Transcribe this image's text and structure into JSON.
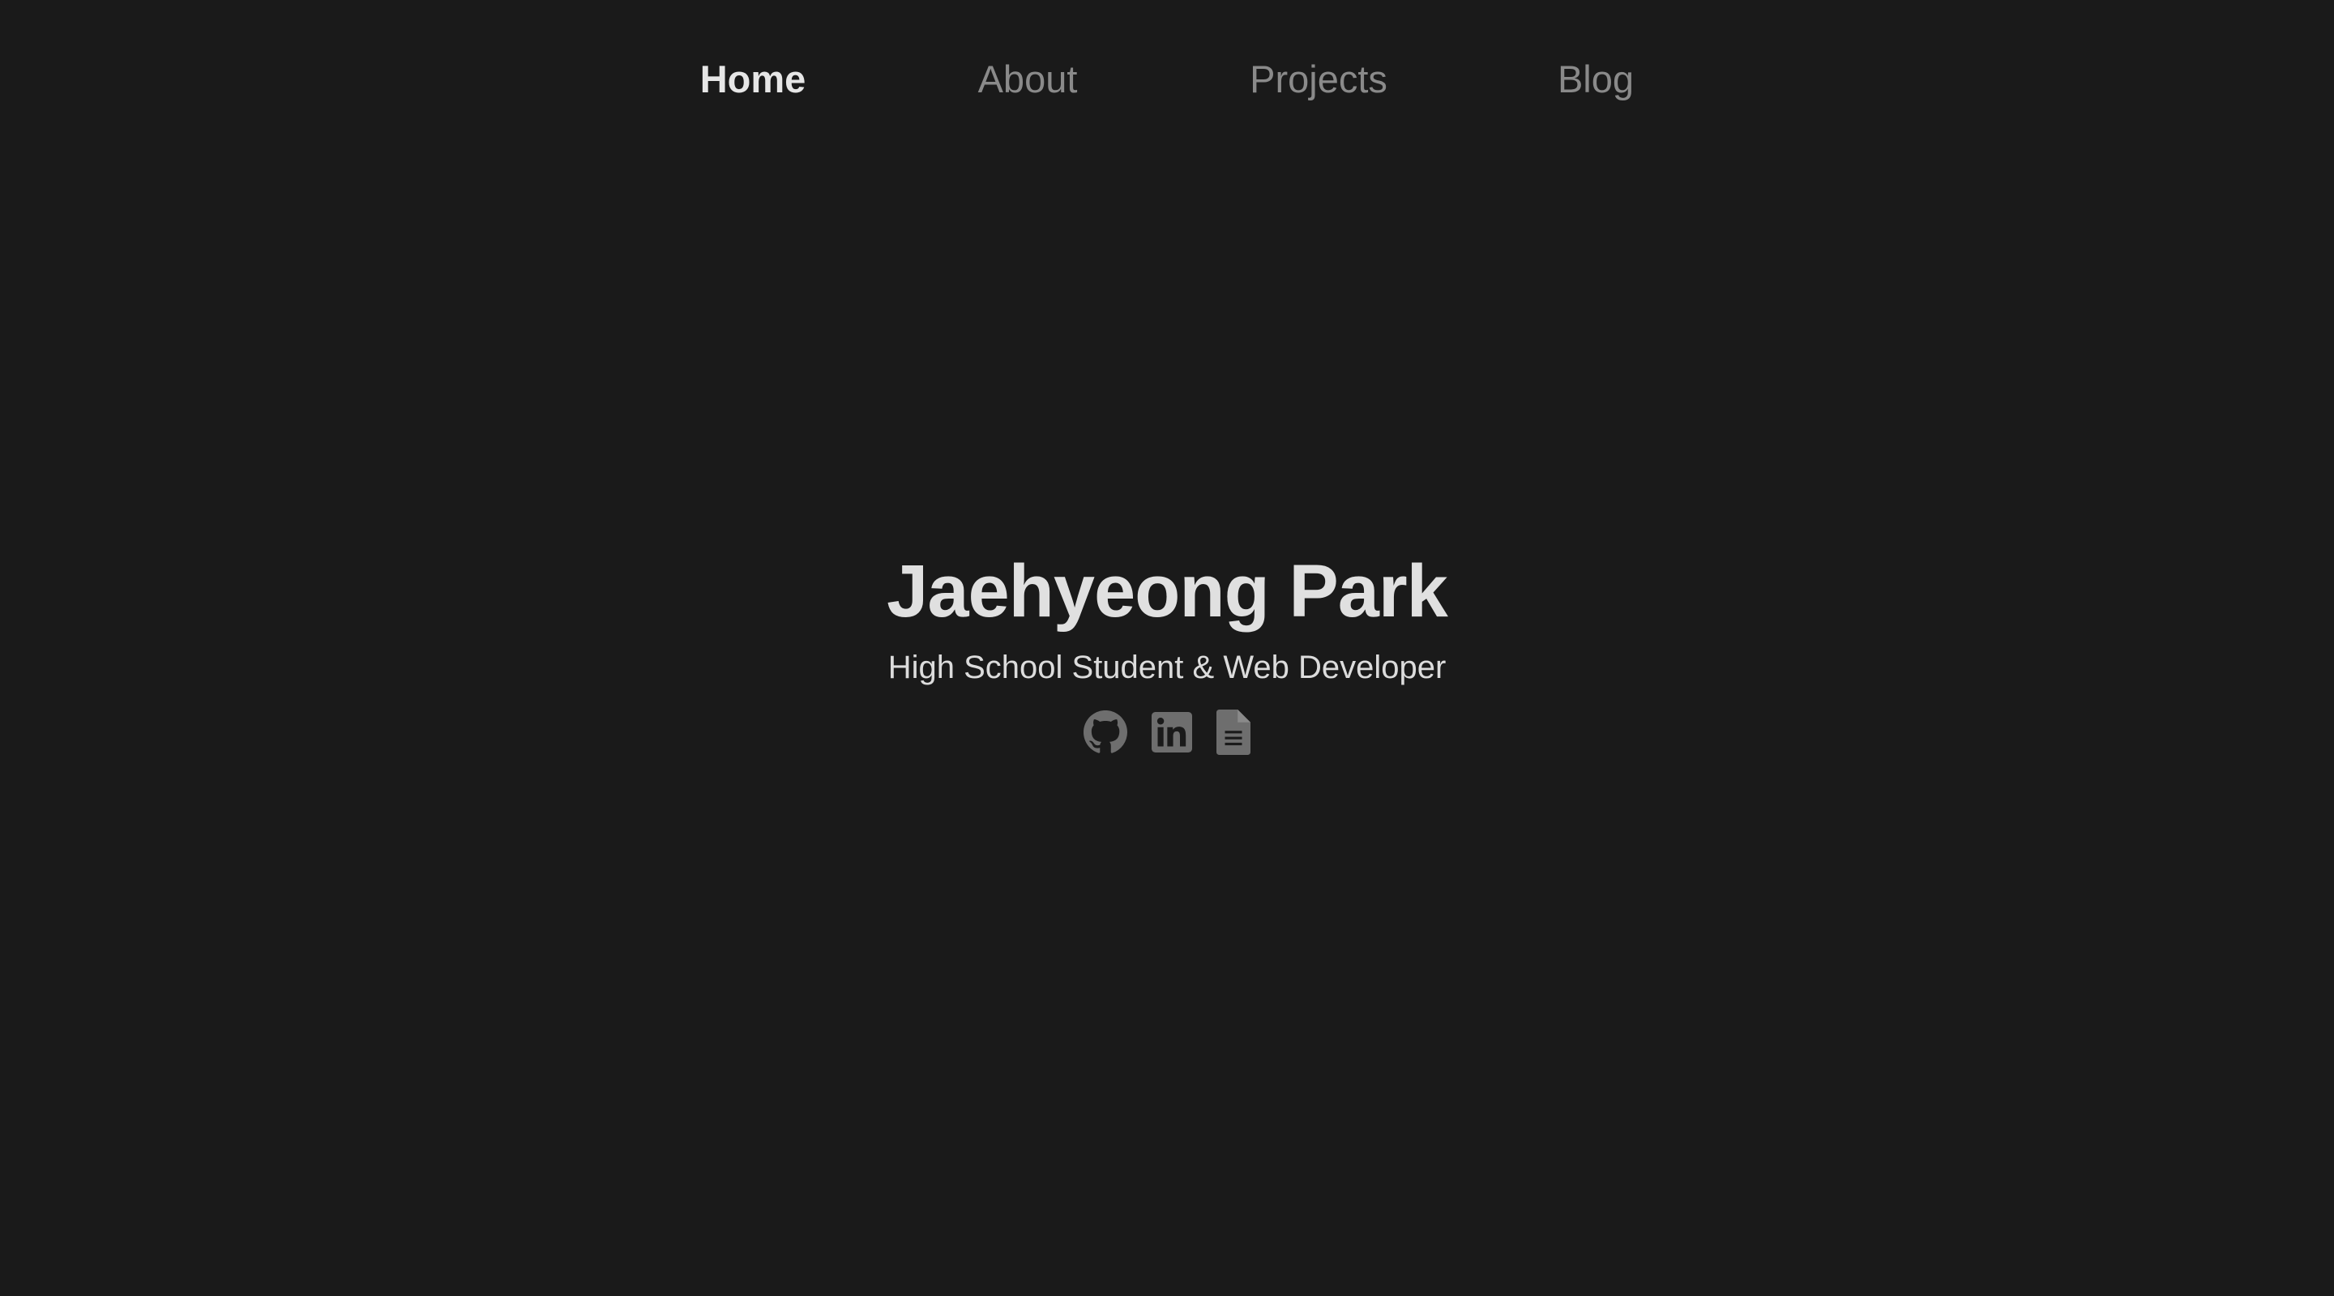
{
  "nav": {
    "items": [
      {
        "label": "Home",
        "active": true
      },
      {
        "label": "About",
        "active": false
      },
      {
        "label": "Projects",
        "active": false
      },
      {
        "label": "Blog",
        "active": false
      }
    ]
  },
  "hero": {
    "name": "Jaehyeong Park",
    "tagline": "High School Student & Web Developer",
    "links": [
      {
        "icon": "github-icon"
      },
      {
        "icon": "linkedin-icon"
      },
      {
        "icon": "document-icon"
      }
    ]
  },
  "colors": {
    "background": "#1a1a1a",
    "nav_active": "#e6e6e6",
    "nav_inactive": "#8a8a8a",
    "title": "#e0e0e0",
    "icon": "#6e6e6e"
  }
}
